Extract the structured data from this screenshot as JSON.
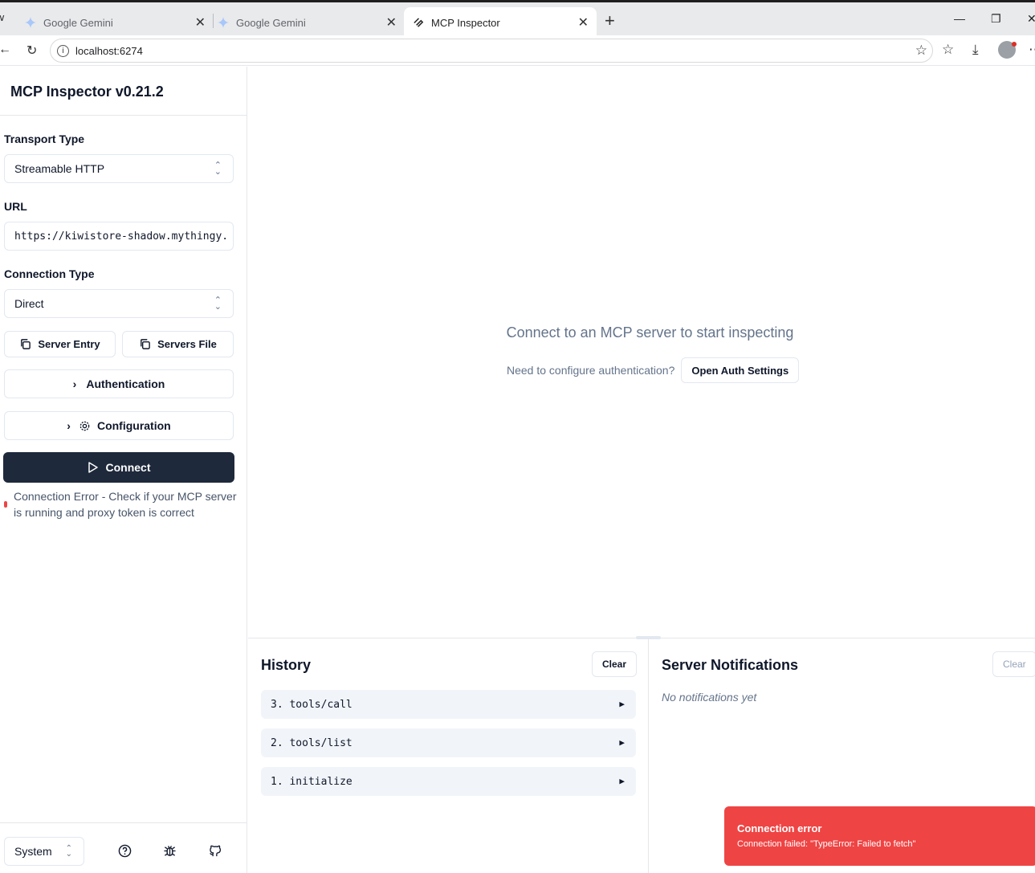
{
  "browser": {
    "tabs": [
      {
        "title": "Google Gemini",
        "icon": "gemini-icon"
      },
      {
        "title": "Google Gemini",
        "icon": "gemini-icon"
      },
      {
        "title": "MCP Inspector",
        "icon": "mcp-icon"
      }
    ],
    "url": "localhost:6274"
  },
  "sidebar": {
    "title": "MCP Inspector v0.21.2",
    "transport_label": "Transport Type",
    "transport_value": "Streamable HTTP",
    "url_label": "URL",
    "url_value": "https://kiwistore-shadow.mythingy.",
    "connection_label": "Connection Type",
    "connection_value": "Direct",
    "server_entry_label": "Server Entry",
    "servers_file_label": "Servers File",
    "authentication_label": "Authentication",
    "configuration_label": "Configuration",
    "connect_label": "Connect",
    "error_text": "Connection Error - Check if your MCP server is running and proxy token is correct",
    "theme_value": "System"
  },
  "main": {
    "empty_message": "Connect to an MCP server to start inspecting",
    "auth_question": "Need to configure authentication?",
    "auth_button": "Open Auth Settings"
  },
  "history": {
    "title": "History",
    "clear_label": "Clear",
    "items": [
      "3. tools/call",
      "2. tools/list",
      "1. initialize"
    ]
  },
  "notifications": {
    "title": "Server Notifications",
    "clear_label": "Clear",
    "empty_text": "No notifications yet"
  },
  "toast": {
    "title": "Connection error",
    "description": "Connection failed: \"TypeError: Failed to fetch\"",
    "color": "#ef4444"
  },
  "colors": {
    "primary_button": "#1e293b",
    "error": "#ef4444"
  }
}
